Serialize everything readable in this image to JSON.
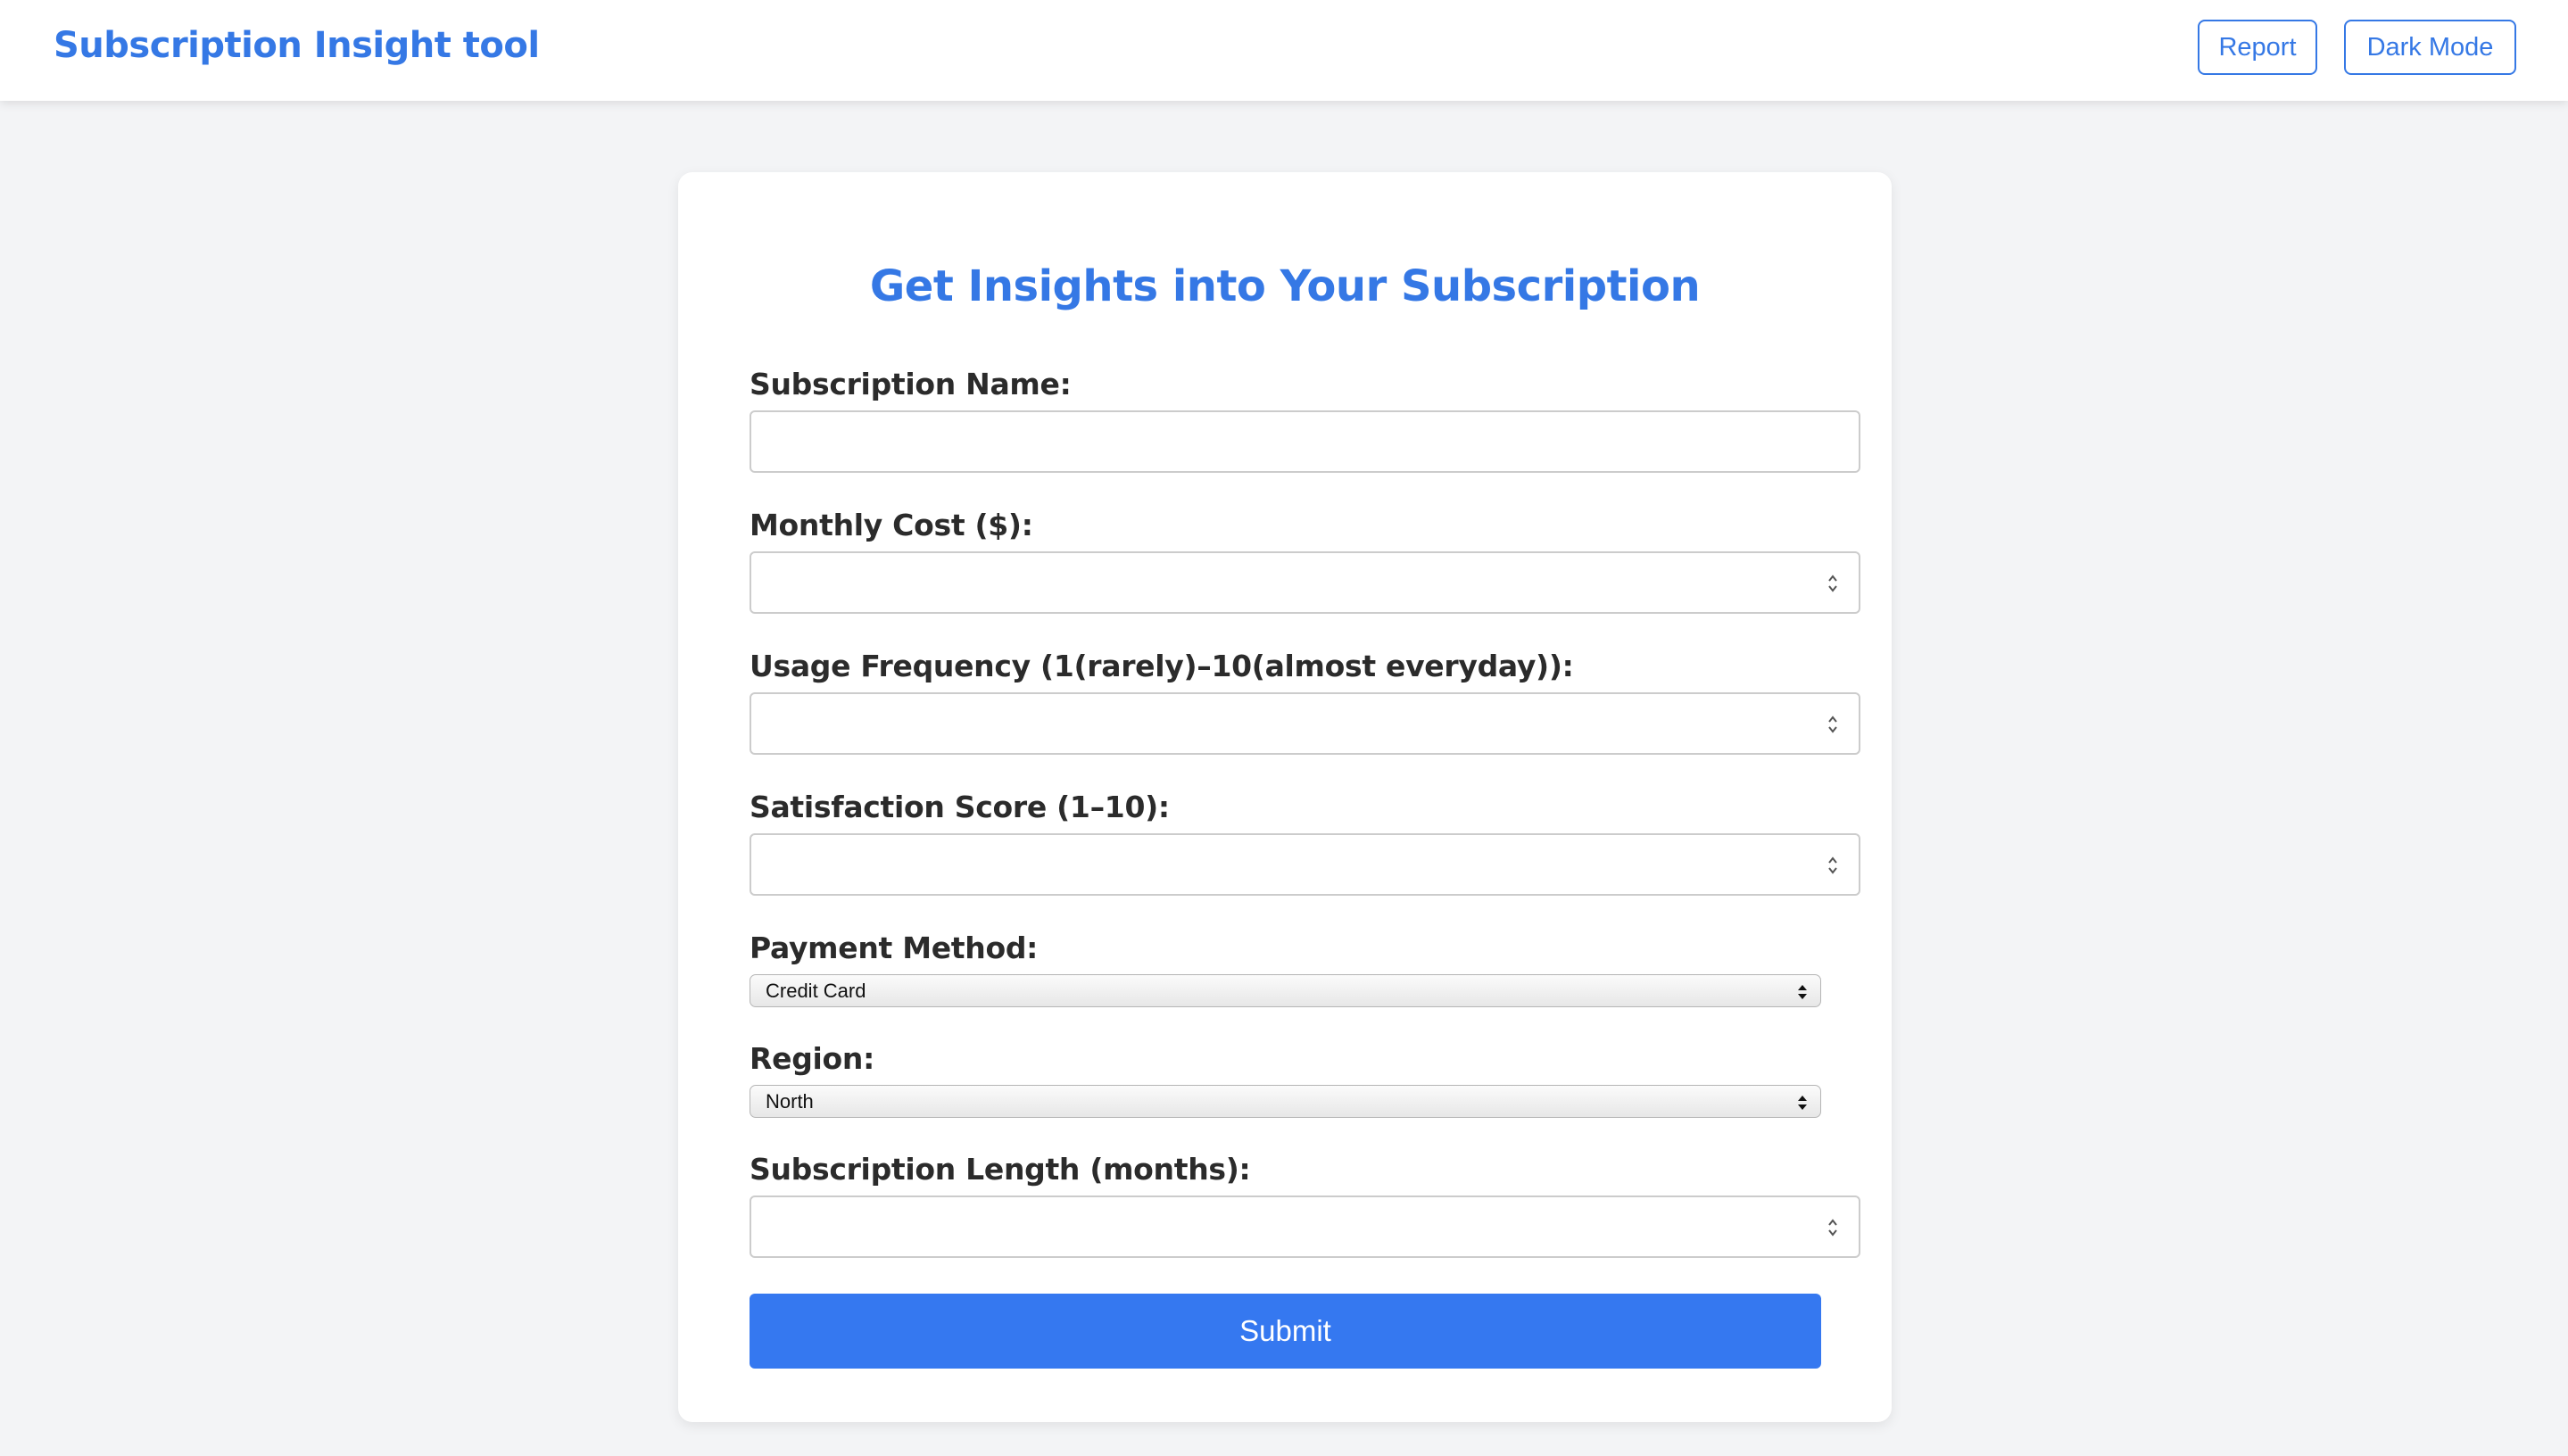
{
  "app": {
    "title": "Subscription Insight tool",
    "report_label": "Report",
    "dark_mode_label": "Dark Mode"
  },
  "form": {
    "title": "Get Insights into Your Subscription",
    "subscription_name": {
      "label": "Subscription Name:",
      "value": ""
    },
    "monthly_cost": {
      "label": "Monthly Cost ($):",
      "value": ""
    },
    "usage_frequency": {
      "label": "Usage Frequency (1(rarely)–10(almost everyday)):",
      "value": ""
    },
    "satisfaction_score": {
      "label": "Satisfaction Score (1–10):",
      "value": ""
    },
    "payment_method": {
      "label": "Payment Method:",
      "selected": "Credit Card"
    },
    "region": {
      "label": "Region:",
      "selected": "North"
    },
    "subscription_length": {
      "label": "Subscription Length (months):",
      "value": ""
    },
    "submit_label": "Submit"
  },
  "colors": {
    "accent": "#3578e5",
    "submit_bg": "#3578f0",
    "page_bg": "#f3f4f6",
    "card_bg": "#ffffff",
    "label_text": "#2b2b2b"
  },
  "icons": {
    "number_spinner": "spinner-arrows-icon",
    "select_arrows": "select-arrows-icon"
  }
}
